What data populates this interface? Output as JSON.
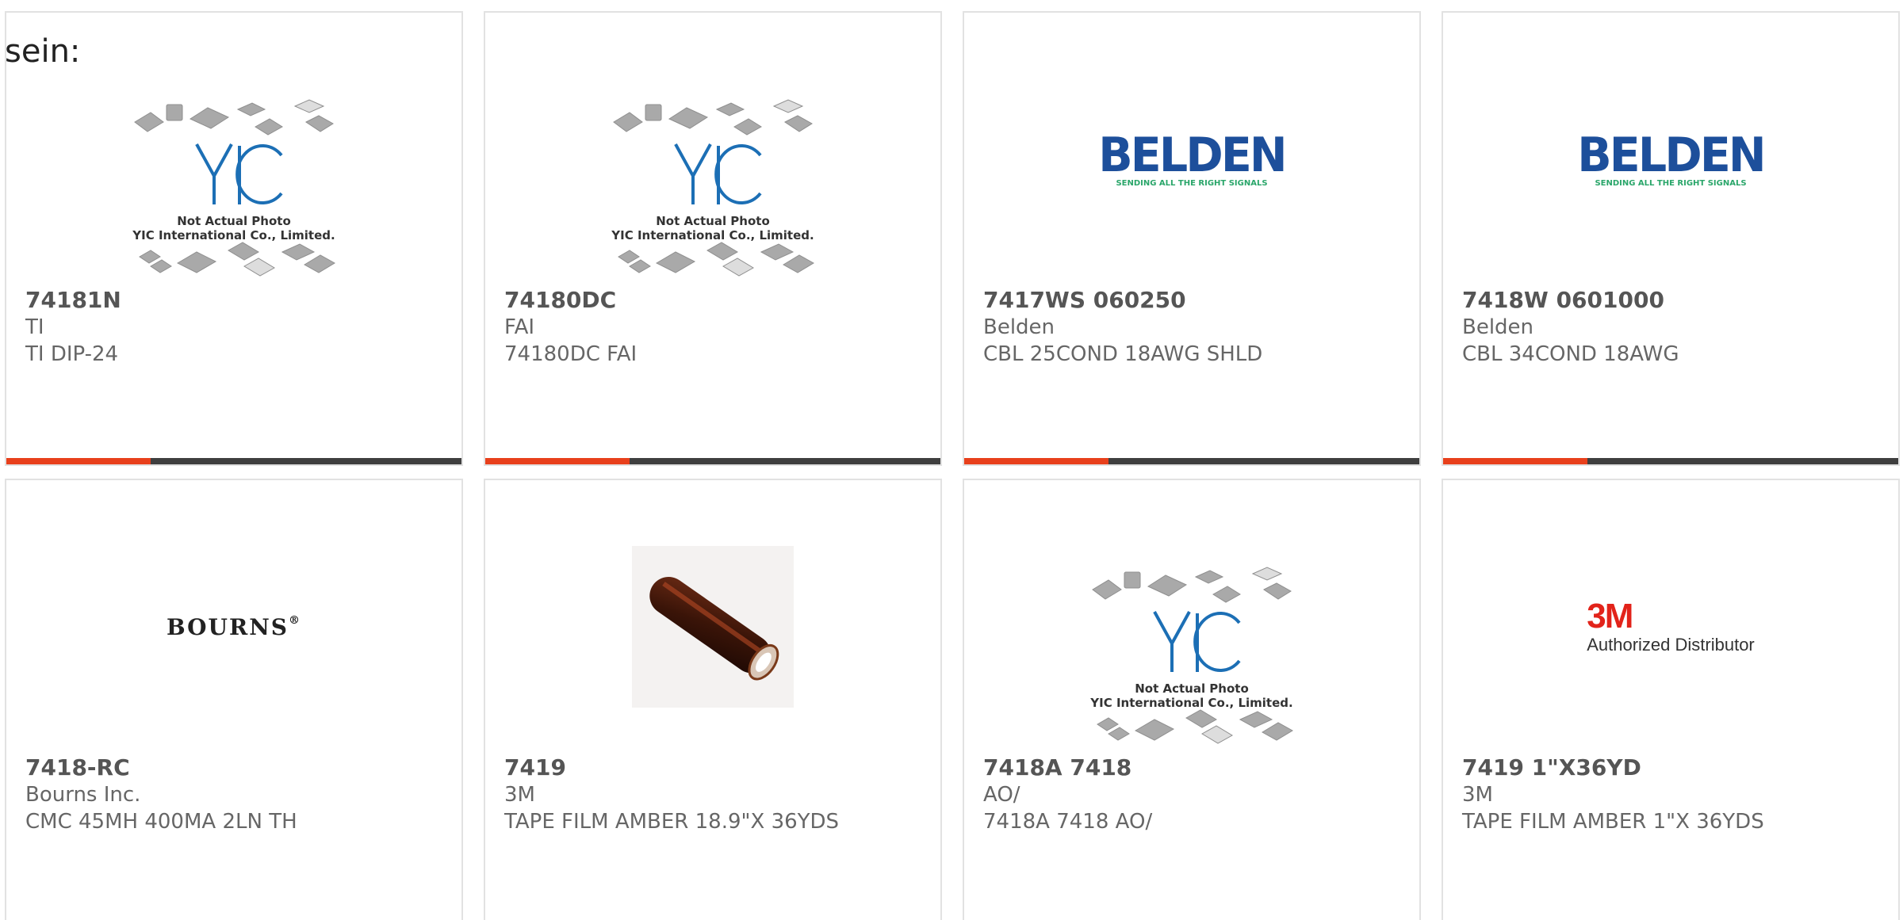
{
  "prefix_text": "sein:",
  "placeholder": {
    "line1": "Not Actual Photo",
    "line2": "YIC International Co., Limited."
  },
  "belden": {
    "word": "BELDEN",
    "tagline": "SENDING ALL THE RIGHT SIGNALS"
  },
  "bourns": {
    "word": "BOURNS"
  },
  "mmm": {
    "word": "3M",
    "tag": "Authorized Distributor"
  },
  "colors": {
    "accent": "#e8401c",
    "bar": "#3f3f3f",
    "belden_blue": "#1d4f9b",
    "belden_green": "#2aa66a",
    "mmm_red": "#e2231a"
  },
  "products": [
    {
      "part": "74181N",
      "manufacturer": "TI",
      "description": "TI DIP-24",
      "image": "yic-placeholder-icon"
    },
    {
      "part": "74180DC",
      "manufacturer": "FAI",
      "description": "74180DC FAI",
      "image": "yic-placeholder-icon"
    },
    {
      "part": "7417WS 060250",
      "manufacturer": "Belden",
      "description": "CBL 25COND 18AWG SHLD",
      "image": "belden-logo"
    },
    {
      "part": "7418W 0601000",
      "manufacturer": "Belden",
      "description": "CBL 34COND 18AWG",
      "image": "belden-logo"
    },
    {
      "part": "7418-RC",
      "manufacturer": "Bourns Inc.",
      "description": "CMC 45MH 400MA 2LN TH",
      "image": "bourns-logo"
    },
    {
      "part": "7419",
      "manufacturer": "3M",
      "description": "TAPE FILM AMBER 18.9\"X 36YDS",
      "image": "tape-roll-photo"
    },
    {
      "part": "7418A 7418",
      "manufacturer": "AO/",
      "description": "7418A 7418 AO/",
      "image": "yic-placeholder-icon"
    },
    {
      "part": "7419 1\"X36YD",
      "manufacturer": "3M",
      "description": "TAPE FILM AMBER 1\"X 36YDS",
      "image": "3m-logo"
    }
  ]
}
